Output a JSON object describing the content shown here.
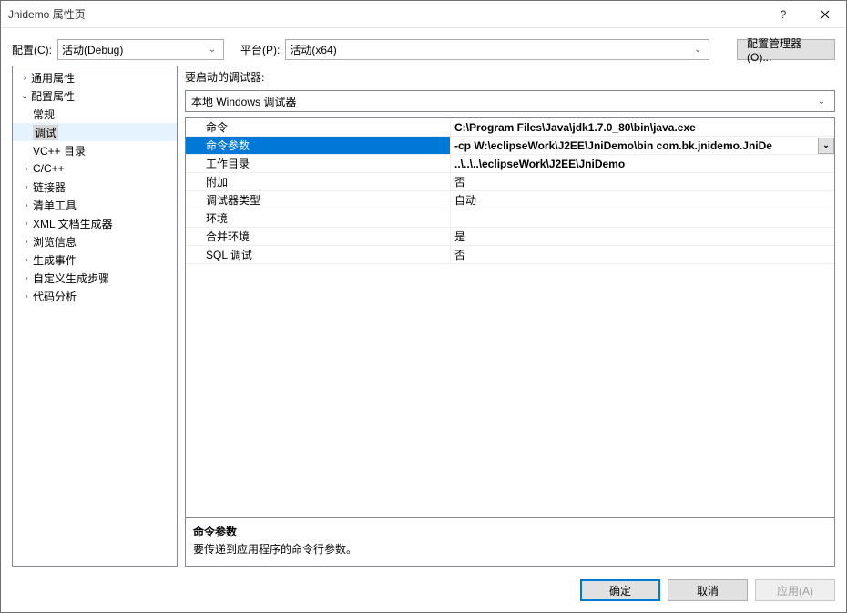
{
  "title": "Jnidemo 属性页",
  "toprow": {
    "config_label": "配置(C):",
    "config_value": "活动(Debug)",
    "platform_label": "平台(P):",
    "platform_value": "活动(x64)",
    "manager_label": "配置管理器(O)..."
  },
  "tree": [
    {
      "label": "通用属性",
      "level": 0,
      "arrow": "closed"
    },
    {
      "label": "配置属性",
      "level": 0,
      "arrow": "open"
    },
    {
      "label": "常规",
      "level": 1,
      "arrow": ""
    },
    {
      "label": "调试",
      "level": 1,
      "arrow": "",
      "selected": true
    },
    {
      "label": "VC++ 目录",
      "level": 1,
      "arrow": ""
    },
    {
      "label": "C/C++",
      "level": 1,
      "arrow": "closed"
    },
    {
      "label": "链接器",
      "level": 1,
      "arrow": "closed"
    },
    {
      "label": "清单工具",
      "level": 1,
      "arrow": "closed"
    },
    {
      "label": "XML 文档生成器",
      "level": 1,
      "arrow": "closed"
    },
    {
      "label": "浏览信息",
      "level": 1,
      "arrow": "closed"
    },
    {
      "label": "生成事件",
      "level": 1,
      "arrow": "closed"
    },
    {
      "label": "自定义生成步骤",
      "level": 1,
      "arrow": "closed"
    },
    {
      "label": "代码分析",
      "level": 1,
      "arrow": "closed"
    }
  ],
  "section_title": "要启动的调试器:",
  "debugger_value": "本地 Windows 调试器",
  "props": [
    {
      "k": "命令",
      "v": "C:\\Program Files\\Java\\jdk1.7.0_80\\bin\\java.exe",
      "bold": true
    },
    {
      "k": "命令参数",
      "v": "-cp W:\\eclipseWork\\J2EE\\JniDemo\\bin com.bk.jnidemo.JniDe",
      "bold": true,
      "selected": true,
      "dropdown": true
    },
    {
      "k": "工作目录",
      "v": "..\\..\\..\\eclipseWork\\J2EE\\JniDemo",
      "bold": true
    },
    {
      "k": "附加",
      "v": "否"
    },
    {
      "k": "调试器类型",
      "v": "自动"
    },
    {
      "k": "环境",
      "v": ""
    },
    {
      "k": "合并环境",
      "v": "是"
    },
    {
      "k": "SQL 调试",
      "v": "否"
    }
  ],
  "desc": {
    "title": "命令参数",
    "body": "要传递到应用程序的命令行参数。"
  },
  "footer": {
    "ok": "确定",
    "cancel": "取消",
    "apply": "应用(A)"
  }
}
